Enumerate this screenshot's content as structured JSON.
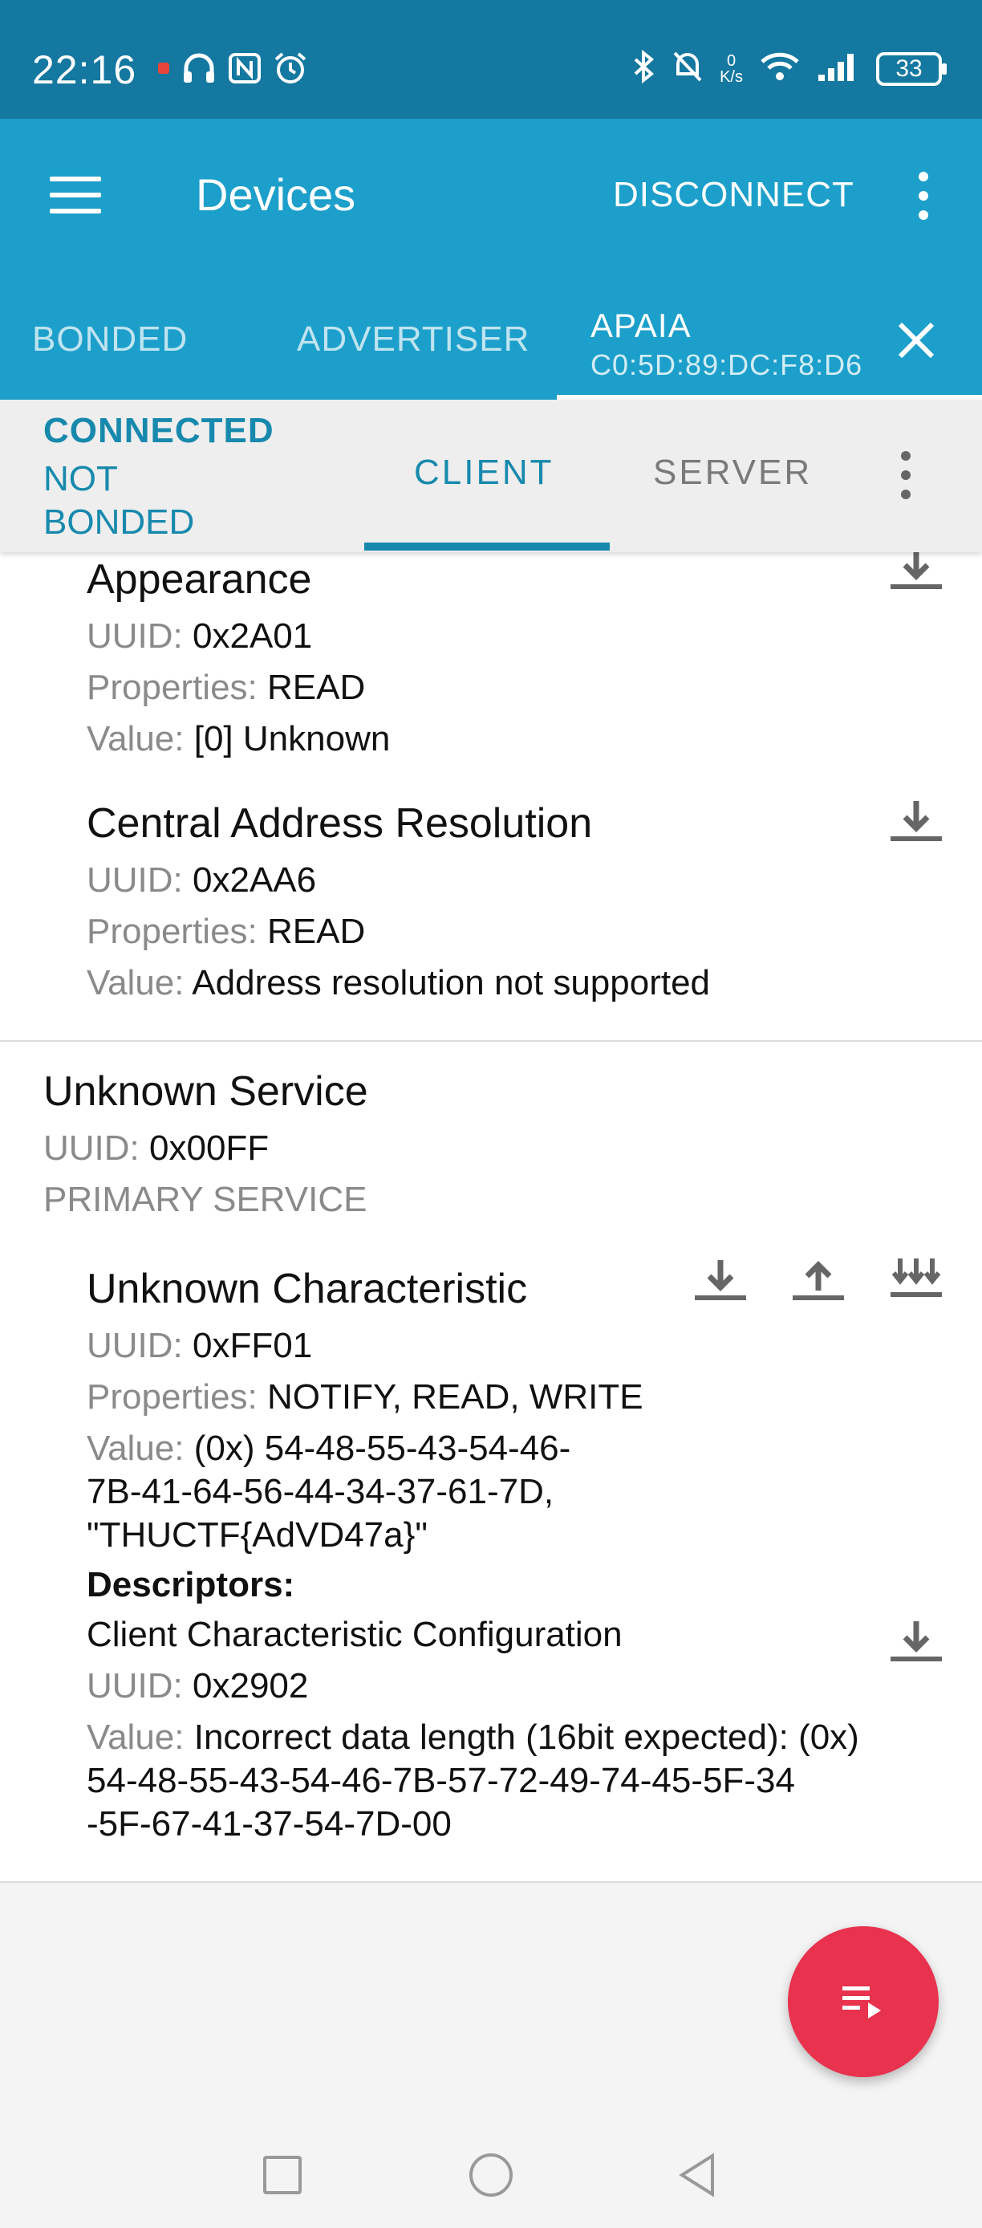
{
  "status_bar": {
    "time": "22:16",
    "net_speed_value": "0",
    "net_speed_unit": "K/s",
    "battery": "33",
    "icons_left": [
      "notification-app-icon",
      "headphones-icon",
      "nfc-icon",
      "alarm-icon"
    ],
    "icons_right": [
      "bluetooth-icon",
      "mute-icon",
      "wifi-icon",
      "signal-icon",
      "battery-icon"
    ]
  },
  "app_bar": {
    "title": "Devices",
    "disconnect_label": "DISCONNECT",
    "tabs": [
      {
        "label": "BONDED"
      },
      {
        "label": "ADVERTISER"
      }
    ],
    "device_tab": {
      "name": "APAIA",
      "mac": "C0:5D:89:DC:F8:D6"
    },
    "colors": {
      "primary": "#1c9fca",
      "status_bar": "#1478a0",
      "accent": "#1789ad",
      "fab": "#e8324e"
    }
  },
  "connection": {
    "status": "CONNECTED",
    "bond_state": "NOT BONDED",
    "subtabs": [
      {
        "label": "CLIENT",
        "selected": true
      },
      {
        "label": "SERVER",
        "selected": false
      }
    ]
  },
  "labels": {
    "uuid": "UUID:",
    "properties": "Properties:",
    "value": "Value:",
    "descriptors": "Descriptors:"
  },
  "characteristics_top": [
    {
      "name": "Appearance",
      "uuid": "0x2A01",
      "properties": "READ",
      "value": "[0] Unknown"
    },
    {
      "name": "Central Address Resolution",
      "uuid": "0x2AA6",
      "properties": "READ",
      "value": "Address resolution not supported"
    }
  ],
  "service": {
    "name": "Unknown Service",
    "uuid": "0x00FF",
    "type": "PRIMARY SERVICE",
    "characteristic": {
      "name": "Unknown Characteristic",
      "uuid": "0xFF01",
      "properties": "NOTIFY, READ, WRITE",
      "value_line1": "(0x) 54-48-55-43-54-46-",
      "value_line2": "7B-41-64-56-44-34-37-61-7D,",
      "value_line3": "\"THUCTF{AdVD47a}\"",
      "descriptor": {
        "name": "Client Characteristic Configuration",
        "uuid": "0x2902",
        "value_line1": "Incorrect data length (16bit expected): (0x)",
        "value_line2": "54-48-55-43-54-46-7B-57-72-49-74-45-5F-34",
        "value_line3": "-5F-67-41-37-54-7D-00"
      }
    }
  }
}
